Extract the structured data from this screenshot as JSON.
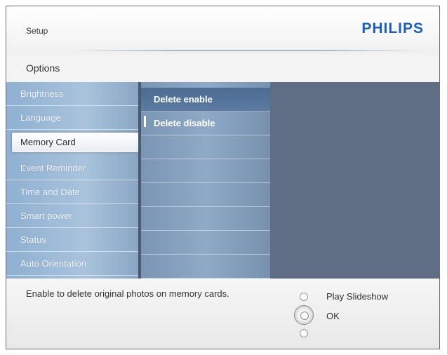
{
  "header": {
    "title": "Setup",
    "brand": "PHILIPS"
  },
  "section": {
    "title": "Options"
  },
  "menu": {
    "items": [
      {
        "label": "Brightness"
      },
      {
        "label": "Language"
      },
      {
        "label": "Memory Card"
      },
      {
        "label": "Event Reminder"
      },
      {
        "label": "Time and Date"
      },
      {
        "label": "Smart power"
      },
      {
        "label": "Status"
      },
      {
        "label": "Auto Orientation"
      }
    ],
    "selected": "Memory Card"
  },
  "submenu": {
    "items": [
      {
        "label": "Delete enable"
      },
      {
        "label": "Delete disable"
      }
    ],
    "highlighted": "Delete enable"
  },
  "footer": {
    "description": "Enable to delete original photos on memory cards.",
    "hint_up": "Play Slideshow",
    "hint_ok": "OK"
  },
  "colors": {
    "brand": "#1f5fb0",
    "menu_background": "#5f6e85",
    "menu_column": "#a9c3dc"
  }
}
